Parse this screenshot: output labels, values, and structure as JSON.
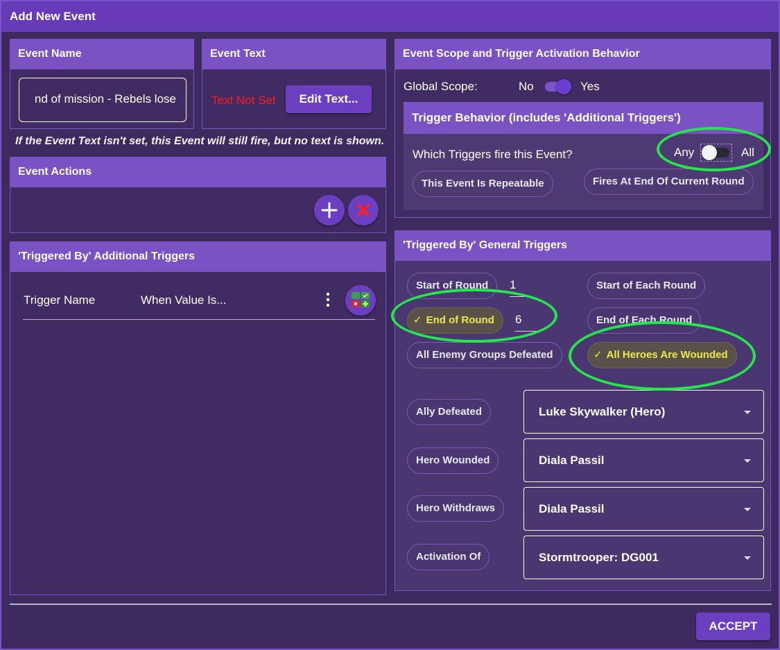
{
  "dialog": {
    "title": "Add New Event"
  },
  "event_name": {
    "header": "Event Name",
    "value": "nd of mission - Rebels lose"
  },
  "event_text": {
    "header": "Event Text",
    "status": "Text Not Set",
    "edit_button": "Edit Text..."
  },
  "notice": "If the Event Text isn't set, this Event will still fire, but no text is shown.",
  "event_actions": {
    "header": "Event Actions",
    "add_icon": "plus-icon",
    "remove_icon": "close-icon"
  },
  "additional_triggers": {
    "header": "'Triggered By' Additional Triggers",
    "col_name": "Trigger Name",
    "col_value": "When Value Is...",
    "menu_icon": "more-vert-icon",
    "add_icon": "add-trigger-icon"
  },
  "scope": {
    "header": "Event Scope and Trigger Activation Behavior",
    "global_label": "Global Scope:",
    "global_no": "No",
    "global_yes": "Yes",
    "trigger_behavior_header": "Trigger Behavior (includes 'Additional Triggers')",
    "which_label": "Which Triggers fire this Event?",
    "any_label": "Any",
    "all_label": "All",
    "repeatable_chip": "This Event Is Repeatable",
    "end_round_chip": "Fires At End Of Current Round"
  },
  "general_triggers": {
    "header": "'Triggered By' General Triggers",
    "start_of_round": "Start of Round",
    "start_of_round_value": "1",
    "start_each_round": "Start of Each Round",
    "end_of_round": "End of Round",
    "end_of_round_value": "6",
    "end_each_round": "End of Each Round",
    "all_enemy_defeated": "All Enemy Groups Defeated",
    "all_heroes_wounded": "All Heroes Are Wounded",
    "ally_defeated": "Ally Defeated",
    "ally_defeated_value": "Luke Skywalker (Hero)",
    "hero_wounded": "Hero Wounded",
    "hero_wounded_value": "Diala Passil",
    "hero_withdraws": "Hero Withdraws",
    "hero_withdraws_value": "Diala Passil",
    "activation_of": "Activation Of",
    "activation_of_value": "Stormtrooper: DG001",
    "check_icon": "check-icon",
    "dropdown_icon": "chevron-down-icon"
  },
  "footer": {
    "accept": "ACCEPT"
  },
  "colors": {
    "background": "#3d2b5f",
    "titlebar": "#673ab7",
    "panel_header": "#7b52c4",
    "button": "#6b3fc0",
    "warning_text": "#ff1a1a",
    "selected_chip_text": "#eaea50",
    "highlight_ellipse": "#23e84a"
  }
}
